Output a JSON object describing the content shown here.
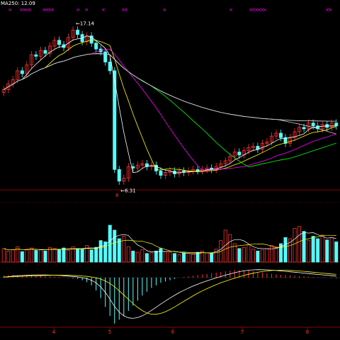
{
  "header": {
    "ma_label": "MA250: 12.09"
  },
  "price_panel": {
    "markers": [
      14,
      30,
      34,
      38,
      42,
      62,
      66,
      70,
      74,
      110,
      122,
      146,
      174,
      178,
      232,
      326,
      354,
      358,
      362,
      366,
      370,
      374,
      462,
      466
    ],
    "peak_label": "17.14",
    "low_label": "6.31",
    "gap_marker": "8"
  },
  "bottom_axis": {
    "labels": [
      "4",
      "5",
      "6",
      "7",
      "8"
    ]
  },
  "colors": {
    "up": "#ff3232",
    "down": "#54ffff",
    "ma5": "#ffffff",
    "ma10": "#ffff00",
    "ma20": "#ff00ff",
    "ma30": "#00ff00",
    "ma60": "#c8c8c8",
    "ma120": "#3232ff",
    "ma250": "#e0e0c0",
    "separator": "#8b0000",
    "marker": "#ff00ff",
    "axis_text": "#ff3232"
  },
  "chart_data": [
    {
      "type": "candlestick",
      "title": "",
      "series": [
        {
          "name": "close",
          "values": [
            12.9,
            13.3,
            13.6,
            14.2,
            14.0,
            14.6,
            15.3,
            15.2,
            15.6,
            15.4,
            15.9,
            16.3,
            16.0,
            15.8,
            16.5,
            17.0,
            16.7,
            16.2,
            16.6,
            16.1,
            15.7,
            15.5,
            14.8,
            14.2,
            7.4,
            6.6,
            6.8,
            7.6,
            7.5,
            7.7,
            7.8,
            7.6,
            7.7,
            7.3,
            7.0,
            7.2,
            7.3,
            7.1,
            7.3,
            7.2,
            7.3,
            7.4,
            7.3,
            7.4,
            7.5,
            7.4,
            7.6,
            7.8,
            8.0,
            8.3,
            8.6,
            8.4,
            8.7,
            8.9,
            9.0,
            8.8,
            9.2,
            9.3,
            9.7,
            9.9,
            9.6,
            9.2,
            9.6,
            10.0,
            10.3,
            10.2,
            10.6,
            10.4,
            10.2,
            10.5,
            10.3,
            10.6,
            10.4
          ]
        }
      ],
      "highlights": {
        "high": 17.14,
        "low": 6.31
      },
      "ylim": [
        6.0,
        18.0
      ]
    },
    {
      "type": "bar",
      "title": "",
      "series": [
        {
          "name": "volume",
          "values": [
            22,
            18,
            20,
            25,
            17,
            21,
            23,
            19,
            20,
            18,
            24,
            22,
            20,
            23,
            19,
            25,
            22,
            21,
            27,
            20,
            24,
            35,
            33,
            60,
            52,
            38,
            42,
            25,
            18,
            16,
            20,
            14,
            15,
            18,
            22,
            17,
            16,
            14,
            12,
            15,
            14,
            13,
            16,
            18,
            15,
            14,
            21,
            35,
            52,
            45,
            30,
            22,
            24,
            28,
            21,
            18,
            20,
            22,
            27,
            25,
            30,
            40,
            38,
            55,
            58,
            50,
            35,
            42,
            38,
            44,
            36,
            40,
            33
          ]
        }
      ]
    },
    {
      "type": "bar",
      "title": "",
      "series": [
        {
          "name": "histogram",
          "values": [
            0.18,
            0.2,
            0.22,
            0.2,
            0.18,
            0.2,
            0.18,
            0.16,
            0.15,
            0.12,
            0.1,
            0.08,
            0.05,
            0.02,
            -0.02,
            -0.05,
            -0.1,
            -0.2,
            -0.35,
            -0.6,
            -1.0,
            -1.6,
            -2.3,
            -3.0,
            -3.6,
            -3.3,
            -3.0,
            -2.6,
            -2.2,
            -1.8,
            -1.4,
            -1.1,
            -0.8,
            -0.6,
            -0.4,
            -0.3,
            -0.2,
            -0.1,
            0.0,
            0.05,
            0.1,
            0.15,
            0.2,
            0.25,
            0.3,
            0.35,
            0.4,
            0.45,
            0.5,
            0.55,
            0.6,
            0.6,
            0.58,
            0.55,
            0.5,
            0.45,
            0.4,
            0.35,
            0.3,
            0.25,
            0.22,
            0.2,
            0.18,
            0.15,
            0.12,
            0.1,
            0.08,
            0.06,
            0.04,
            0.02,
            0.0,
            -0.02,
            -0.04
          ]
        }
      ]
    }
  ]
}
